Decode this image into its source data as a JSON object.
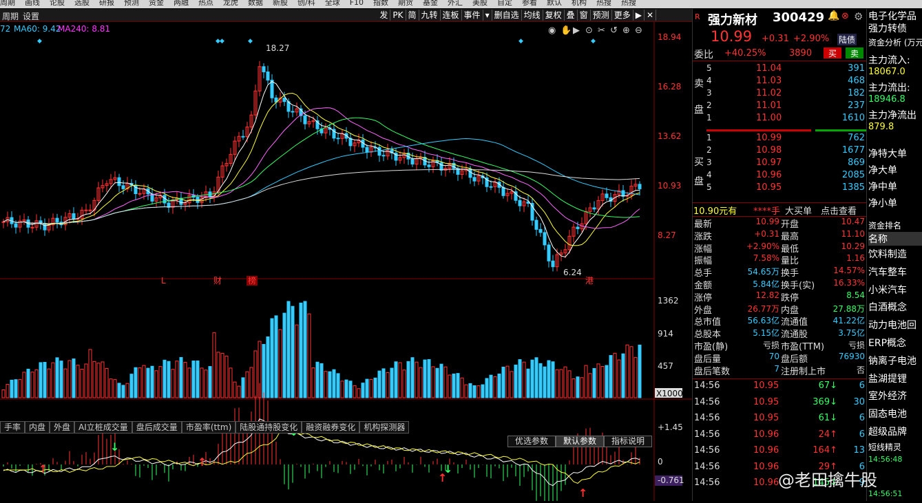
{
  "topnav": [
    "周期",
    "画线",
    "论股",
    "选股",
    "研报",
    "预测",
    "资金",
    "两融",
    "热点",
    "龙虎",
    "数据",
    "新股",
    "创/科",
    "全球",
    "F10",
    "指数",
    "期货",
    "基金",
    "外汇",
    "美股",
    "自定",
    "参看",
    "默认",
    "机构",
    "热搜",
    "热搜"
  ],
  "menubar": {
    "left": [
      "周期",
      "设置"
    ],
    "tools": [
      "发",
      "PK",
      "简",
      "九转",
      "连板",
      "事件",
      "▾",
      "删自选",
      "均线",
      "复权",
      "叠",
      "窗",
      "预测",
      "更多",
      "▶",
      "✕"
    ]
  },
  "ma_legend": {
    "ma60": "MA60: 9.42",
    "ma240": "MA240: 8.81",
    "prefix": "72"
  },
  "price_axis": [
    "18.94",
    "16.28",
    "13.62",
    "10.93",
    "8.27"
  ],
  "price_hi": "18.27",
  "price_lo": "6.24",
  "markers": [
    "L",
    "财",
    "榜",
    "港"
  ],
  "vol_axis": [
    "1362",
    "914",
    "457"
  ],
  "vol_unit": "X1000",
  "macd_axis": [
    "+1.45",
    "0",
    "-0.761"
  ],
  "tabs": [
    "手率",
    "内盘",
    "外盘",
    "AI立桩成交量",
    "盘后成交量",
    "市盈率(ttm)",
    "陆股通持股变化",
    "融资融券变化",
    "机构探测器"
  ],
  "macd_btns": [
    "优选参数",
    "默认参数",
    "指标说明"
  ],
  "stock": {
    "flag": "R",
    "name": "强力新材",
    "code": "300429",
    "price": "10.99",
    "chg": "+0.31",
    "pct": "+2.90%",
    "tag": "陆债"
  },
  "weibi": {
    "label": "委比",
    "pct": "+40.25%",
    "val": "3890",
    "buy": "买",
    "sell": "卖"
  },
  "sell": [
    [
      "5",
      "11.04",
      "391"
    ],
    [
      "4",
      "11.03",
      "468"
    ],
    [
      "3",
      "11.02",
      "182"
    ],
    [
      "2",
      "11.01",
      "237"
    ],
    [
      "1",
      "11.00",
      "1610"
    ]
  ],
  "buy": [
    [
      "1",
      "10.99",
      "762"
    ],
    [
      "2",
      "10.98",
      "1677"
    ],
    [
      "3",
      "10.97",
      "869"
    ],
    [
      "4",
      "10.96",
      "2085"
    ],
    [
      "5",
      "10.95",
      "1385"
    ]
  ],
  "sell_label": [
    "卖",
    "盘"
  ],
  "buy_label": [
    "买",
    "盘"
  ],
  "bigorder": {
    "price": "10.90元有",
    "stars": "****手",
    "label": "大买单",
    "link": "点击查看"
  },
  "stats": [
    [
      "最新",
      "10.99",
      "开盘",
      "10.47"
    ],
    [
      "涨跌",
      "+0.31",
      "最高",
      "11.10"
    ],
    [
      "涨幅",
      "+2.90%",
      "最低",
      "10.29"
    ],
    [
      "振幅",
      "7.58%",
      "量比",
      "1.16"
    ],
    [
      "总手",
      "54.65万",
      "换手",
      "14.57%"
    ],
    [
      "金额",
      "5.84亿",
      "换手(实)",
      "16.33%"
    ],
    [
      "涨停",
      "12.82",
      "跌停",
      "8.54"
    ],
    [
      "外盘",
      "26.77万",
      "内盘",
      "27.88万"
    ],
    [
      "总市值",
      "56.63亿",
      "流通值",
      "41.22亿"
    ],
    [
      "总股本",
      "5.15亿",
      "流通股",
      "3.75亿"
    ],
    [
      "市盈(静)",
      "亏损",
      "市盈(TTM)",
      "亏损"
    ],
    [
      "盘后量",
      "70",
      "盘后额",
      "76930"
    ],
    [
      "盘后笔数",
      "7",
      "注册制上市",
      "否"
    ]
  ],
  "ticks": [
    [
      "14:56",
      "10.95",
      "67",
      "6"
    ],
    [
      "14:56",
      "10.95",
      "369",
      "30"
    ],
    [
      "14:56",
      "10.95",
      "61",
      "6"
    ],
    [
      "14:56",
      "10.96",
      "24",
      "6"
    ],
    [
      "14:56",
      "10.96",
      "164",
      "13"
    ],
    [
      "14:56",
      "10.96",
      "29",
      "6"
    ],
    [
      "14:56",
      "10.96",
      "145",
      "9"
    ]
  ],
  "sidebar": {
    "top": [
      "电子化学品",
      "强力转债"
    ],
    "fund_title": "资金分析 (万元)",
    "fund": [
      [
        "主力流入:",
        "18067.0"
      ],
      [
        "主力流出:",
        "18946.8"
      ],
      [
        "主力净流出",
        "879.8"
      ]
    ],
    "orders": [
      "净特大单",
      "净大单",
      "净中单",
      "净小单"
    ],
    "rank_title": "资金排名",
    "name_hdr": "名称",
    "concepts": [
      "饮料制造",
      "汽车整车",
      "小米汽车",
      "白酒概念",
      "动力电池回",
      "ERP概念",
      "钠离子电池",
      "盐湖提锂",
      "室外经济",
      "固态电池",
      "超级品牌"
    ],
    "sprite": "短线精灵",
    "sprite_rows": [
      "14:56:48",
      "14:56:51"
    ]
  },
  "watermark": "@老田擒牛股",
  "colors": {
    "up": "#ff3333",
    "down": "#33ccff",
    "ma5": "#ffffff",
    "ma10": "#ffff33",
    "ma20": "#ff66ff",
    "ma30": "#33ff66",
    "ma60": "#33ccff",
    "ma240": "#dddddd"
  }
}
